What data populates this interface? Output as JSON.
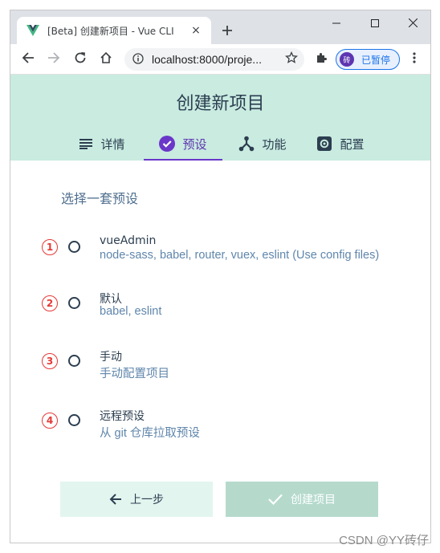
{
  "browser": {
    "tab_title": "[Beta] 创建新项目 - Vue CLI",
    "tab_close": "×",
    "url": "localhost:8000/proje...",
    "profile_avatar": "砖",
    "profile_status": "已暂停"
  },
  "app": {
    "title": "创建新项目",
    "steps": [
      {
        "label": "详情",
        "icon": "details-list-icon"
      },
      {
        "label": "预设",
        "icon": "check-circle-icon"
      },
      {
        "label": "功能",
        "icon": "fork-icon"
      },
      {
        "label": "配置",
        "icon": "gear-icon"
      }
    ],
    "active_step": "预设",
    "accent_color": "#6a37c9",
    "header_bg": "#c9ebe0"
  },
  "content": {
    "section_title": "选择一套预设",
    "presets": [
      {
        "marker": "1",
        "name": "vueAdmin",
        "desc": "node-sass, babel, router, vuex, eslint (Use config files)"
      },
      {
        "marker": "2",
        "name": "默认",
        "desc": "babel, eslint"
      },
      {
        "marker": "3",
        "name": "手动",
        "desc": "手动配置项目"
      },
      {
        "marker": "4",
        "name": "远程预设",
        "desc": "从 git 仓库拉取预设"
      }
    ],
    "prev_button": "上一步",
    "create_button": "创建项目"
  },
  "watermark": "CSDN @YY砖仔"
}
